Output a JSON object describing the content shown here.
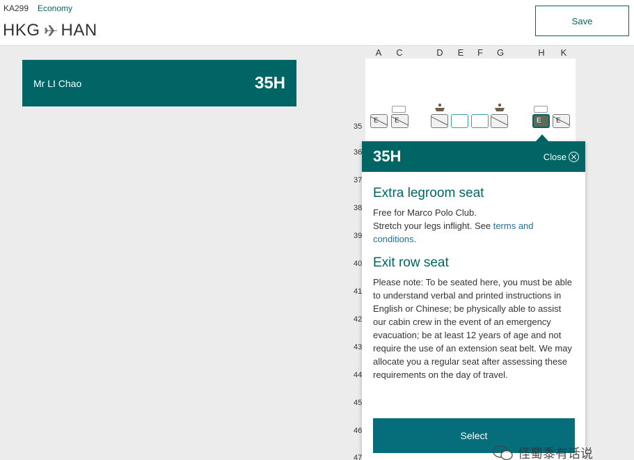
{
  "header": {
    "flight_number": "KA299",
    "cabin": "Economy",
    "origin": "HKG",
    "destination": "HAN",
    "save_label": "Save"
  },
  "passenger": {
    "name": "Mr LI Chao",
    "seat": "35H"
  },
  "seat_columns": [
    "A",
    "C",
    "D",
    "E",
    "F",
    "G",
    "H",
    "K"
  ],
  "rows": [
    "35",
    "36",
    "37",
    "38",
    "39",
    "40",
    "41",
    "42",
    "43",
    "44",
    "45",
    "46",
    "47"
  ],
  "seats_row35": [
    {
      "label": "E",
      "status": "unavailable"
    },
    {
      "label": "E",
      "status": "unavailable"
    },
    {
      "label": "",
      "status": "unavailable"
    },
    {
      "label": "",
      "status": "available"
    },
    {
      "label": "",
      "status": "available"
    },
    {
      "label": "",
      "status": "unavailable"
    },
    {
      "label": "E",
      "status": "selected"
    },
    {
      "label": "E",
      "status": "unavailable"
    }
  ],
  "popup": {
    "seat": "35H",
    "close_label": "Close",
    "section1_title": "Extra legroom seat",
    "section1_line1": "Free for Marco Polo Club.",
    "section1_line2": "Stretch your legs inflight. See ",
    "section1_link": "terms and conditions",
    "section1_end": ".",
    "section2_title": "Exit row seat",
    "section2_text": "Please note: To be seated here, you must be able to understand verbal and printed instructions in English or Chinese; be physically able to assist our cabin crew in the event of an emergency evacuation; be at least 12 years of age and not require the use of an extension seat belt. We may allocate you a regular seat after assessing these requirements on the day of travel.",
    "select_label": "Select"
  },
  "watermark": "怪蜀黍有话说",
  "colors": {
    "brand_teal": "#006564",
    "button_teal": "#066d7a",
    "link": "#1f6f9a",
    "background": "#ececec"
  },
  "icons": {
    "route": "plane-icon",
    "close": "close-circle-icon",
    "bassinet": "bassinet-icon",
    "watermark": "wechat-icon"
  }
}
